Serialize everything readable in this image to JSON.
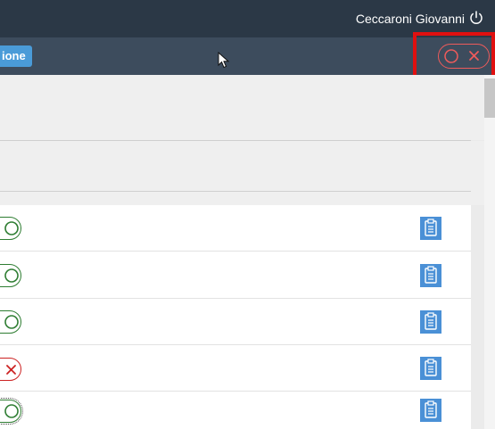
{
  "header": {
    "user_name": "Ceccaroni Giovanni",
    "power_icon": "power-icon"
  },
  "toolbar": {
    "partial_button_label": "ione",
    "toggle_icons": [
      "circle-icon",
      "close-icon"
    ],
    "toggle_accent": "#ee5b5b"
  },
  "rows": [
    {
      "status": "ok",
      "icon": "circle-icon",
      "action_icon": "clipboard-icon"
    },
    {
      "status": "ok",
      "icon": "circle-icon",
      "action_icon": "clipboard-icon"
    },
    {
      "status": "ok",
      "icon": "circle-icon",
      "action_icon": "clipboard-icon"
    },
    {
      "status": "ko",
      "icon": "close-icon",
      "action_icon": "clipboard-icon"
    },
    {
      "status": "ok",
      "icon": "circle-icon",
      "action_icon": "clipboard-icon"
    }
  ],
  "colors": {
    "header_bg": "#2b3846",
    "toolbar_bg": "#3d4c5d",
    "primary_button": "#4a9bd8",
    "ok": "#2e7d32",
    "ko": "#cc2222",
    "highlight": "#e01010"
  }
}
